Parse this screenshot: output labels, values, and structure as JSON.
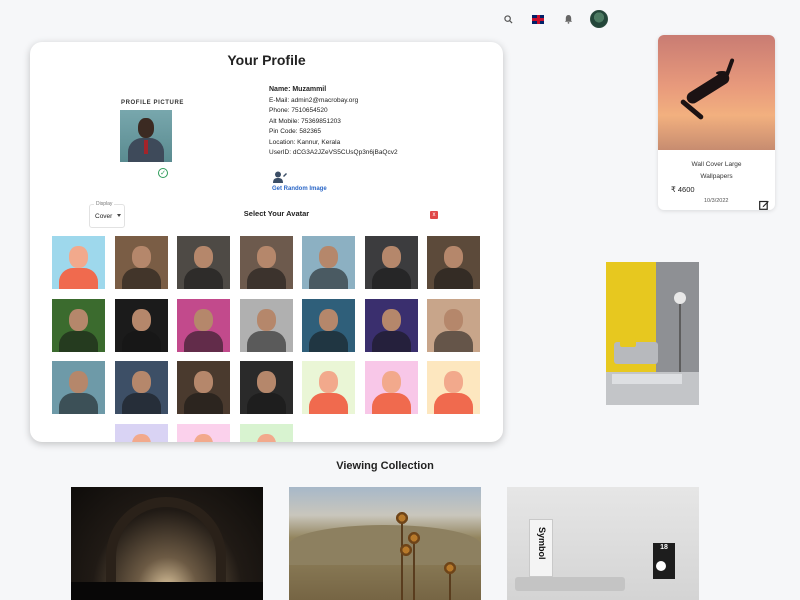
{
  "header": {
    "icons": [
      "search-icon",
      "uk-flag-icon",
      "bell-icon",
      "user-avatar"
    ]
  },
  "profile": {
    "title": "Your Profile",
    "picture_label": "PROFILE PICTURE",
    "name": "Name: Muzammil",
    "email": "E-Mail: admin2@macrobay.org",
    "phone": "Phone: 7510654520",
    "alt_mobile": "Alt Mobile: 75369851203",
    "pin_code": "Pin Code: 582365",
    "location": "Location: Kannur, Kerala",
    "user_id": "UserID: dCG3A2JZeVS5CUsQp3n6jBaQcv2",
    "random_link": "Get Random Image",
    "display": {
      "label": "Display",
      "value": "Cover"
    },
    "select_title": "Select Your Avatar",
    "close": "x"
  },
  "avatars": [
    {
      "name": "cartoon-avatar-1",
      "bg": "#9ed8ec"
    },
    {
      "name": "photo-avatar-2",
      "bg": "#7a5d45"
    },
    {
      "name": "photo-avatar-3",
      "bg": "#4e4a45"
    },
    {
      "name": "photo-avatar-4",
      "bg": "#6d5a4d"
    },
    {
      "name": "photo-avatar-5",
      "bg": "#8cb0c2"
    },
    {
      "name": "photo-avatar-6",
      "bg": "#3c3c3e"
    },
    {
      "name": "photo-avatar-7",
      "bg": "#5c4a3a"
    },
    {
      "name": "photo-avatar-8",
      "bg": "#3b6b2e"
    },
    {
      "name": "photo-avatar-9",
      "bg": "#1b1b1b"
    },
    {
      "name": "photo-avatar-10",
      "bg": "#c24a8c"
    },
    {
      "name": "photo-avatar-11",
      "bg": "#b0b0b0"
    },
    {
      "name": "photo-avatar-12",
      "bg": "#2f5f7a"
    },
    {
      "name": "photo-avatar-13",
      "bg": "#3a2f6e"
    },
    {
      "name": "photo-avatar-14",
      "bg": "#c8a58a"
    },
    {
      "name": "photo-avatar-15",
      "bg": "#6e9aa8"
    },
    {
      "name": "photo-avatar-16",
      "bg": "#3d4f66"
    },
    {
      "name": "photo-avatar-17",
      "bg": "#4a3a2e"
    },
    {
      "name": "photo-avatar-18",
      "bg": "#2a2a2a"
    },
    {
      "name": "cartoon-avatar-19",
      "bg": "#eaf6d6"
    },
    {
      "name": "cartoon-avatar-20",
      "bg": "#f8c7e8"
    },
    {
      "name": "cartoon-avatar-21",
      "bg": "#fde7bf"
    },
    {
      "name": "cartoon-avatar-22",
      "bg": "#d9d3f4"
    },
    {
      "name": "cartoon-avatar-23",
      "bg": "#fbd1ec"
    },
    {
      "name": "cartoon-avatar-24",
      "bg": "#d8f3d0"
    }
  ],
  "wallpaper": {
    "title": "Wall Cover Large",
    "category": "Wallpapers",
    "price": "₹ 4600",
    "date": "10/3/2022"
  },
  "collection": {
    "title": "Viewing Collection",
    "book_text": "Symbol",
    "calendar_day": "18"
  }
}
